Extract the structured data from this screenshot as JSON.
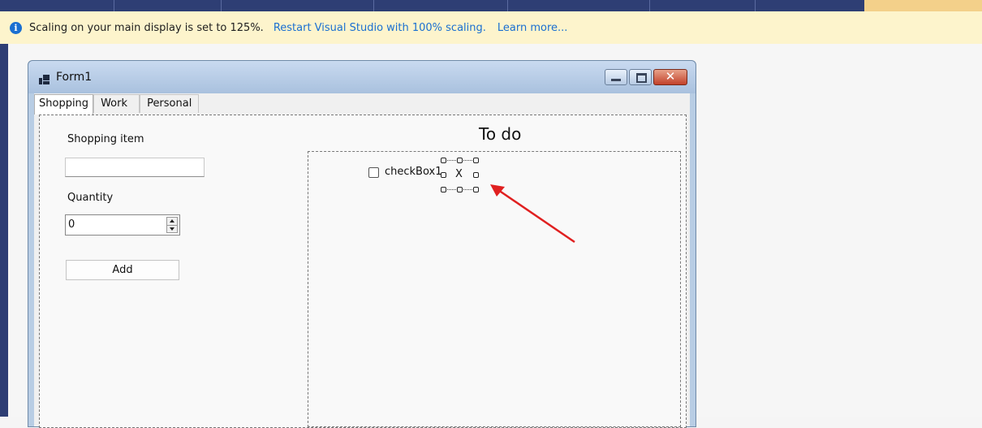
{
  "infobar": {
    "message": "Scaling on your main display is set to 125%.",
    "restart_link": "Restart Visual Studio with 100% scaling.",
    "learn_link": "Learn more...",
    "icon": "info-icon"
  },
  "form": {
    "title": "Form1",
    "close_glyph": "✕",
    "tabs": [
      {
        "label": "Shopping"
      },
      {
        "label": "Work"
      },
      {
        "label": "Personal"
      }
    ],
    "shopping": {
      "item_label": "Shopping item",
      "item_value": "",
      "quantity_label": "Quantity",
      "quantity_value": "0",
      "add_label": "Add"
    },
    "todo": {
      "title": "To do",
      "checkbox_label": "checkBox1",
      "selected_control_text": "X"
    }
  },
  "colors": {
    "accent": "#1a6fd1",
    "infobar_bg": "#fdf4cc",
    "vs_dark": "#2e3e74",
    "annotation_arrow": "#e02020"
  }
}
